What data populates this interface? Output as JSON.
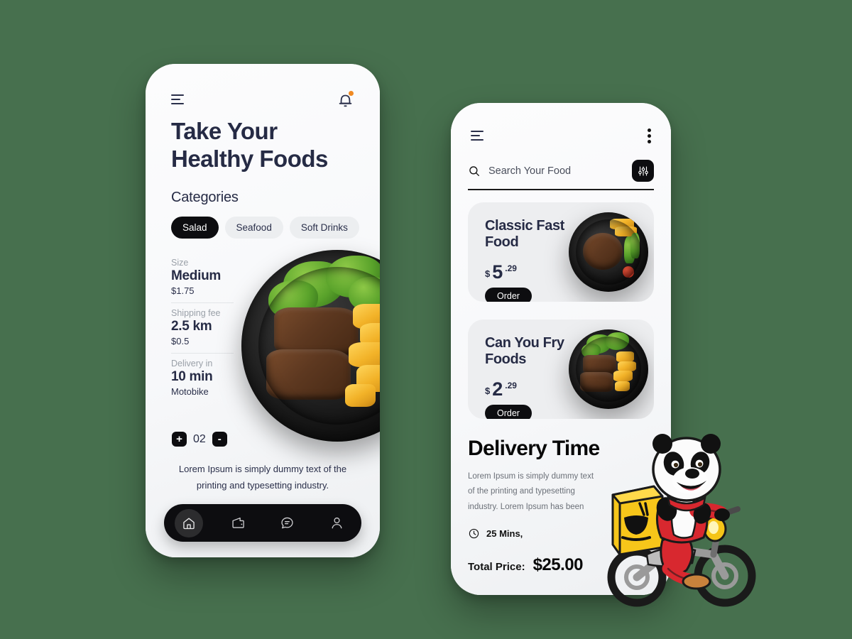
{
  "theme": {
    "background": "#47704e",
    "phone_bg": "#fafbfc",
    "ink": "#262b45",
    "black": "#0d0d10",
    "accent_orange": "#f08a23",
    "chip_bg": "#eceef0",
    "card_bg": "#edeef0"
  },
  "left_phone": {
    "menu_icon": "hamburger-icon",
    "bell_icon": "notification-bell-icon",
    "headline": "Take Your Healthy Foods",
    "section_title": "Categories",
    "categories": [
      {
        "label": "Salad",
        "active": true
      },
      {
        "label": "Seafood",
        "active": false
      },
      {
        "label": "Soft Drinks",
        "active": false
      }
    ],
    "specs": [
      {
        "label": "Size",
        "value": "Medium",
        "sub": "$1.75"
      },
      {
        "label": "Shipping fee",
        "value": "2.5 km",
        "sub": "$0.5"
      },
      {
        "label": "Delivery in",
        "value": "10 min",
        "sub": "Motobike"
      }
    ],
    "stepper": {
      "increase": "+",
      "quantity": "02",
      "decrease": "-"
    },
    "description": "Lorem Ipsum is simply dummy text of the printing and typesetting industry.",
    "tabs": [
      {
        "icon": "home-icon",
        "active": true
      },
      {
        "icon": "wallet-icon",
        "active": false
      },
      {
        "icon": "chat-icon",
        "active": false
      },
      {
        "icon": "profile-icon",
        "active": false
      }
    ]
  },
  "right_phone": {
    "menu_icon": "hamburger-icon",
    "more_icon": "kebab-menu-icon",
    "search": {
      "icon": "search-icon",
      "placeholder": "Search Your Food",
      "value": "",
      "filter_icon": "filter-sliders-icon"
    },
    "food_cards": [
      {
        "title": "Classic Fast Food",
        "currency": "$",
        "price_int": "5",
        "price_dec": ".29",
        "order_label": "Order",
        "image": "grilled-steak-plate"
      },
      {
        "title": "Can You Fry Foods",
        "currency": "$",
        "price_int": "2",
        "price_dec": ".29",
        "order_label": "Order",
        "image": "steak-salad-fries-plate"
      }
    ],
    "delivery": {
      "title": "Delivery Time",
      "body": "Lorem Ipsum is simply dummy text of the printing and typesetting industry. Lorem Ipsum has been",
      "clock_icon": "clock-icon",
      "mins": "25 Mins,",
      "total_label": "Total Price:",
      "total_value": "$25.00"
    }
  },
  "mascot": {
    "name": "panda-delivery-rider-illustration"
  }
}
